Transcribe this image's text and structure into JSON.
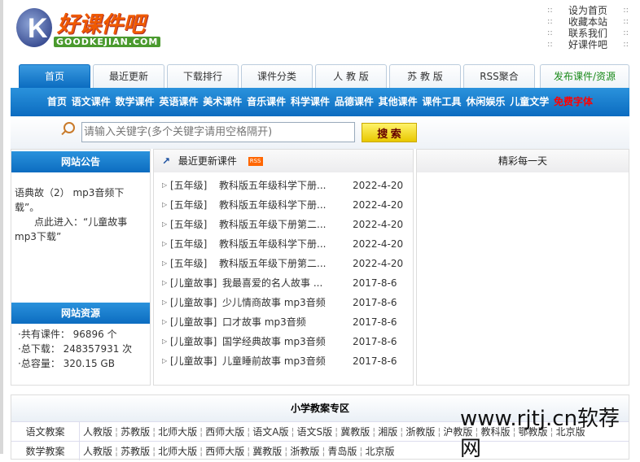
{
  "logo": {
    "cn": "好课件吧",
    "en": "GOODKEJIAN.COM"
  },
  "top_links": [
    "设为首页",
    "收藏本站",
    "联系我们",
    "好课件吧"
  ],
  "top_sep": "::",
  "tabs": [
    "首页",
    "最近更新",
    "下载排行",
    "课件分类",
    "人 教 版",
    "苏 教 版",
    "RSS聚合",
    "发布课件/资源"
  ],
  "nav": [
    "首页",
    "语文课件",
    "数学课件",
    "英语课件",
    "美术课件",
    "音乐课件",
    "科学课件",
    "品德课件",
    "其他课件",
    "课件工具",
    "休闲娱乐",
    "儿童文学",
    "免费字体"
  ],
  "search": {
    "placeholder": "请输入关键字(多个关键字请用空格隔开)",
    "button": "搜 索"
  },
  "notice": {
    "title": "网站公告",
    "lines": [
      "语典故（2） mp3音频下载”。",
      "　　点此进入：“儿童故事mp3下载”"
    ]
  },
  "resources": {
    "title": "网站资源",
    "items": [
      "·共有课件： 96896 个",
      "·总下载： 248357931 次",
      "·总容量： 320.15 GB"
    ]
  },
  "recent": {
    "title": "最近更新课件",
    "rss": "RSS",
    "items": [
      {
        "cat": "[五年级]",
        "title": "教科版五年级科学下册...",
        "date": "2022-4-20"
      },
      {
        "cat": "[五年级]",
        "title": "教科版五年级科学下册...",
        "date": "2022-4-20"
      },
      {
        "cat": "[五年级]",
        "title": "教科版五年级下册第二...",
        "date": "2022-4-20"
      },
      {
        "cat": "[五年级]",
        "title": "教科版五年级科学下册...",
        "date": "2022-4-20"
      },
      {
        "cat": "[五年级]",
        "title": "教科版五年级下册第二...",
        "date": "2022-4-20"
      },
      {
        "cat": "[儿童故事]",
        "title": "我最喜爱的名人故事 ...",
        "date": "2017-8-6"
      },
      {
        "cat": "[儿童故事]",
        "title": "少儿情商故事 mp3音频",
        "date": "2017-8-6"
      },
      {
        "cat": "[儿童故事]",
        "title": "口才故事 mp3音频",
        "date": "2017-8-6"
      },
      {
        "cat": "[儿童故事]",
        "title": "国学经典故事 mp3音频",
        "date": "2017-8-6"
      },
      {
        "cat": "[儿童故事]",
        "title": "儿童睡前故事 mp3音频",
        "date": "2017-8-6"
      }
    ]
  },
  "daily": {
    "title": "精彩每一天"
  },
  "bottom": {
    "title": "小学教案专区",
    "rows": [
      {
        "label": "语文教案",
        "links": [
          "人教版",
          "苏教版",
          "北师大版",
          "西师大版",
          "语文A版",
          "语文S版",
          "冀教版",
          "湘版",
          "浙教版",
          "沪教版",
          "教科版",
          "鄂教版",
          "北京版"
        ]
      },
      {
        "label": "数学教案",
        "links": [
          "人教版",
          "苏教版",
          "北师大版",
          "西师大版",
          "冀教版",
          "浙教版",
          "青岛版",
          "北京版"
        ]
      }
    ]
  },
  "watermark": "www.rjtj.cn软荐网"
}
